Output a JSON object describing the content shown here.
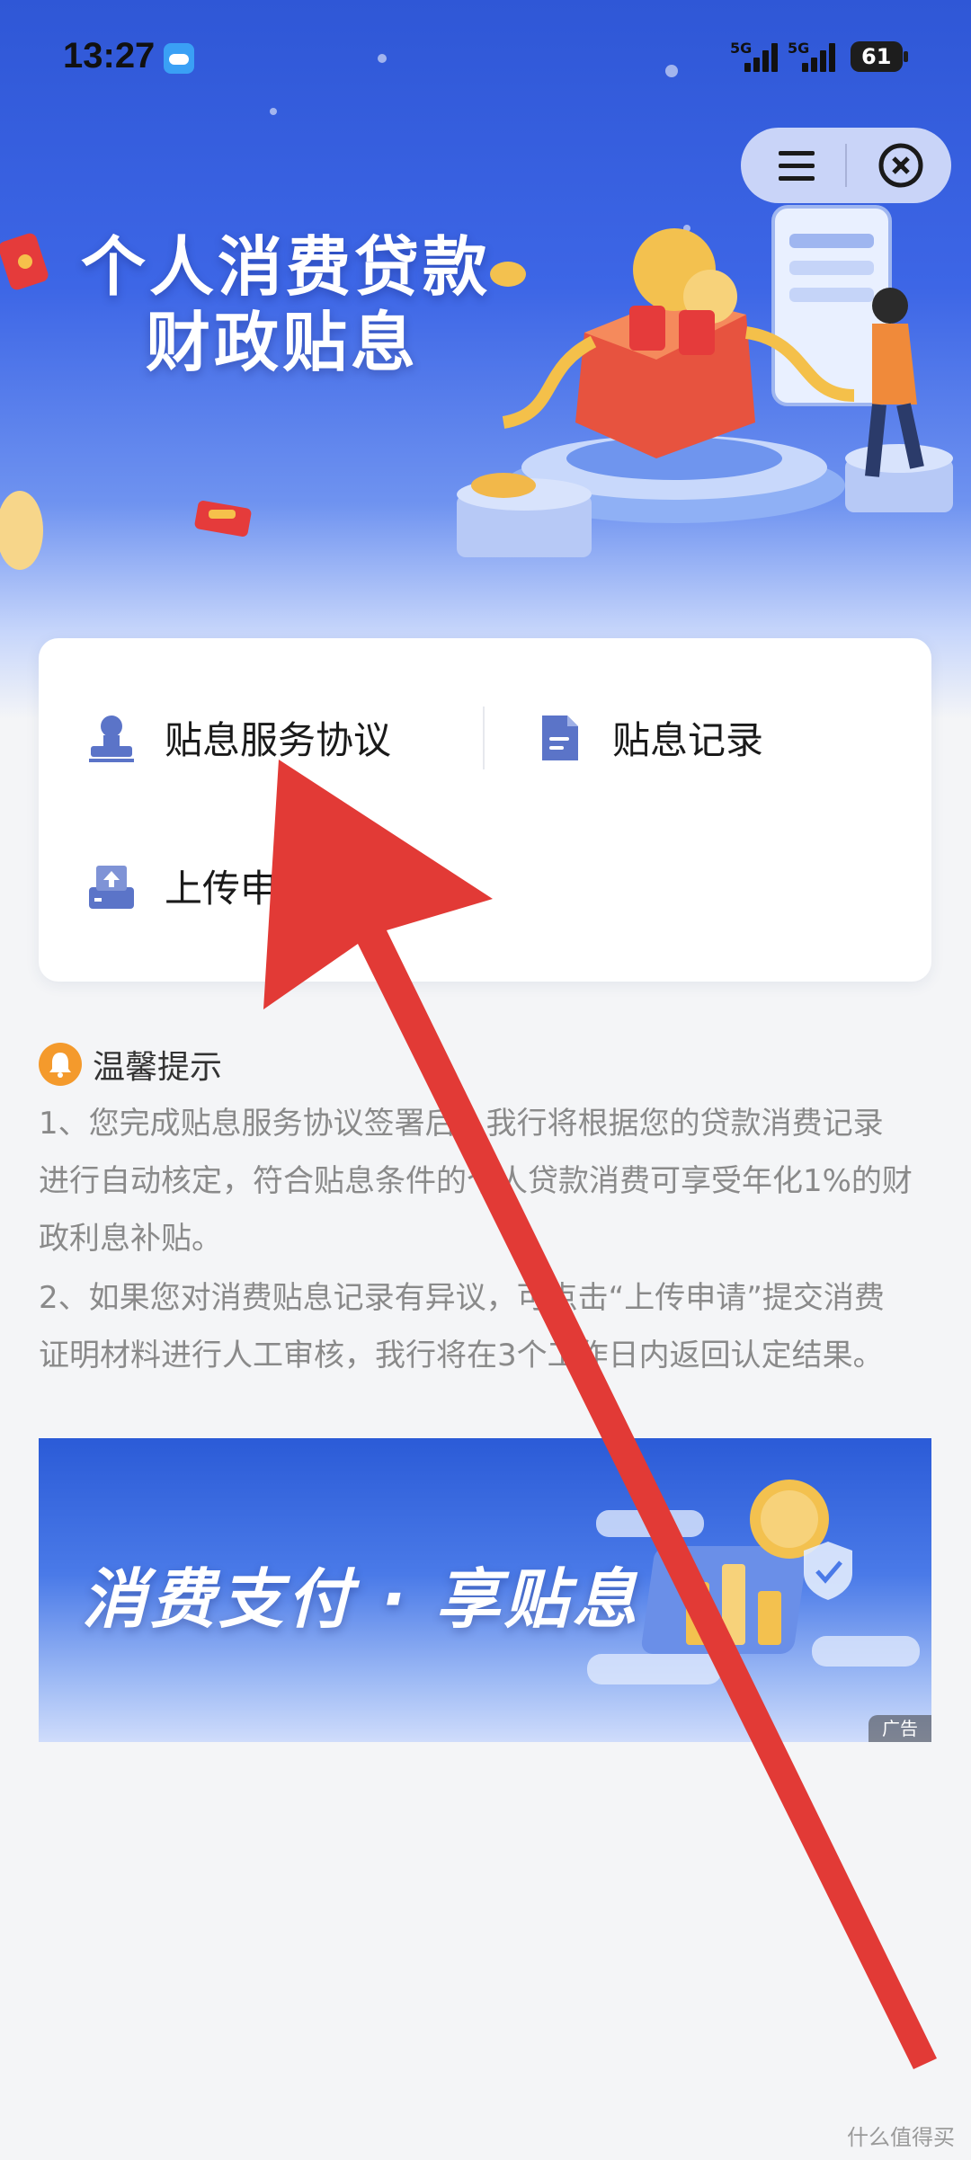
{
  "status_bar": {
    "time": "13:27",
    "network_1": "5G",
    "network_2": "5G",
    "battery": "61"
  },
  "capsule": {
    "menu_icon": "menu-icon",
    "close_icon": "close-circle-icon"
  },
  "hero": {
    "title_line1": "个人消费贷款",
    "title_line2": "财政贴息"
  },
  "card": {
    "items": [
      {
        "label": "贴息服务协议",
        "icon": "stamp-icon"
      },
      {
        "label": "贴息记录",
        "icon": "document-icon"
      },
      {
        "label": "上传申",
        "icon": "upload-icon"
      }
    ]
  },
  "tips": {
    "title": "温馨提示",
    "tip1_line1": "1、您完成贴息服务协议签署后，我行将根据您的贷款消费记录",
    "tip1_line2": "进行自动核定，符合贴息条件的个人贷款消费可享受年化1%的财",
    "tip1_line3": "政利息补贴。",
    "tip2_line1": "2、如果您对消费贴息记录有异议，可点击“上传申请”提交消费",
    "tip2_line2": "证明材料进行人工审核，我行将在3个工作日内返回认定结果。"
  },
  "banner": {
    "text": "消费支付 · 享贴息",
    "ad_label": "广告"
  },
  "watermark": "什么值得买",
  "colors": {
    "hero_blue": "#2f57d6",
    "icon_blue": "#5b74c8",
    "arrow_red": "#e23a36",
    "bell_orange": "#f49a2c"
  }
}
